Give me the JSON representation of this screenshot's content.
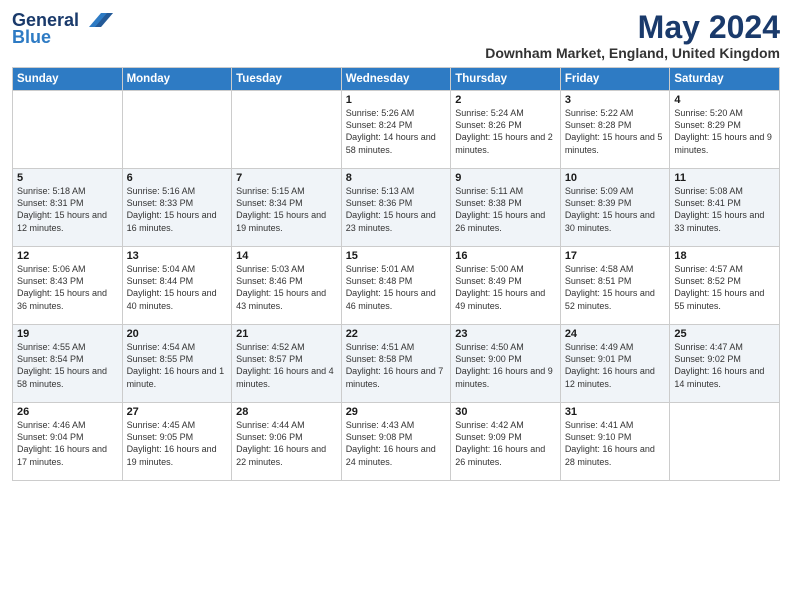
{
  "header": {
    "logo_general": "General",
    "logo_blue": "Blue",
    "month_title": "May 2024",
    "subtitle": "Downham Market, England, United Kingdom"
  },
  "days_of_week": [
    "Sunday",
    "Monday",
    "Tuesday",
    "Wednesday",
    "Thursday",
    "Friday",
    "Saturday"
  ],
  "weeks": [
    [
      {
        "day": "",
        "sunrise": "",
        "sunset": "",
        "daylight": ""
      },
      {
        "day": "",
        "sunrise": "",
        "sunset": "",
        "daylight": ""
      },
      {
        "day": "",
        "sunrise": "",
        "sunset": "",
        "daylight": ""
      },
      {
        "day": "1",
        "sunrise": "Sunrise: 5:26 AM",
        "sunset": "Sunset: 8:24 PM",
        "daylight": "Daylight: 14 hours and 58 minutes."
      },
      {
        "day": "2",
        "sunrise": "Sunrise: 5:24 AM",
        "sunset": "Sunset: 8:26 PM",
        "daylight": "Daylight: 15 hours and 2 minutes."
      },
      {
        "day": "3",
        "sunrise": "Sunrise: 5:22 AM",
        "sunset": "Sunset: 8:28 PM",
        "daylight": "Daylight: 15 hours and 5 minutes."
      },
      {
        "day": "4",
        "sunrise": "Sunrise: 5:20 AM",
        "sunset": "Sunset: 8:29 PM",
        "daylight": "Daylight: 15 hours and 9 minutes."
      }
    ],
    [
      {
        "day": "5",
        "sunrise": "Sunrise: 5:18 AM",
        "sunset": "Sunset: 8:31 PM",
        "daylight": "Daylight: 15 hours and 12 minutes."
      },
      {
        "day": "6",
        "sunrise": "Sunrise: 5:16 AM",
        "sunset": "Sunset: 8:33 PM",
        "daylight": "Daylight: 15 hours and 16 minutes."
      },
      {
        "day": "7",
        "sunrise": "Sunrise: 5:15 AM",
        "sunset": "Sunset: 8:34 PM",
        "daylight": "Daylight: 15 hours and 19 minutes."
      },
      {
        "day": "8",
        "sunrise": "Sunrise: 5:13 AM",
        "sunset": "Sunset: 8:36 PM",
        "daylight": "Daylight: 15 hours and 23 minutes."
      },
      {
        "day": "9",
        "sunrise": "Sunrise: 5:11 AM",
        "sunset": "Sunset: 8:38 PM",
        "daylight": "Daylight: 15 hours and 26 minutes."
      },
      {
        "day": "10",
        "sunrise": "Sunrise: 5:09 AM",
        "sunset": "Sunset: 8:39 PM",
        "daylight": "Daylight: 15 hours and 30 minutes."
      },
      {
        "day": "11",
        "sunrise": "Sunrise: 5:08 AM",
        "sunset": "Sunset: 8:41 PM",
        "daylight": "Daylight: 15 hours and 33 minutes."
      }
    ],
    [
      {
        "day": "12",
        "sunrise": "Sunrise: 5:06 AM",
        "sunset": "Sunset: 8:43 PM",
        "daylight": "Daylight: 15 hours and 36 minutes."
      },
      {
        "day": "13",
        "sunrise": "Sunrise: 5:04 AM",
        "sunset": "Sunset: 8:44 PM",
        "daylight": "Daylight: 15 hours and 40 minutes."
      },
      {
        "day": "14",
        "sunrise": "Sunrise: 5:03 AM",
        "sunset": "Sunset: 8:46 PM",
        "daylight": "Daylight: 15 hours and 43 minutes."
      },
      {
        "day": "15",
        "sunrise": "Sunrise: 5:01 AM",
        "sunset": "Sunset: 8:48 PM",
        "daylight": "Daylight: 15 hours and 46 minutes."
      },
      {
        "day": "16",
        "sunrise": "Sunrise: 5:00 AM",
        "sunset": "Sunset: 8:49 PM",
        "daylight": "Daylight: 15 hours and 49 minutes."
      },
      {
        "day": "17",
        "sunrise": "Sunrise: 4:58 AM",
        "sunset": "Sunset: 8:51 PM",
        "daylight": "Daylight: 15 hours and 52 minutes."
      },
      {
        "day": "18",
        "sunrise": "Sunrise: 4:57 AM",
        "sunset": "Sunset: 8:52 PM",
        "daylight": "Daylight: 15 hours and 55 minutes."
      }
    ],
    [
      {
        "day": "19",
        "sunrise": "Sunrise: 4:55 AM",
        "sunset": "Sunset: 8:54 PM",
        "daylight": "Daylight: 15 hours and 58 minutes."
      },
      {
        "day": "20",
        "sunrise": "Sunrise: 4:54 AM",
        "sunset": "Sunset: 8:55 PM",
        "daylight": "Daylight: 16 hours and 1 minute."
      },
      {
        "day": "21",
        "sunrise": "Sunrise: 4:52 AM",
        "sunset": "Sunset: 8:57 PM",
        "daylight": "Daylight: 16 hours and 4 minutes."
      },
      {
        "day": "22",
        "sunrise": "Sunrise: 4:51 AM",
        "sunset": "Sunset: 8:58 PM",
        "daylight": "Daylight: 16 hours and 7 minutes."
      },
      {
        "day": "23",
        "sunrise": "Sunrise: 4:50 AM",
        "sunset": "Sunset: 9:00 PM",
        "daylight": "Daylight: 16 hours and 9 minutes."
      },
      {
        "day": "24",
        "sunrise": "Sunrise: 4:49 AM",
        "sunset": "Sunset: 9:01 PM",
        "daylight": "Daylight: 16 hours and 12 minutes."
      },
      {
        "day": "25",
        "sunrise": "Sunrise: 4:47 AM",
        "sunset": "Sunset: 9:02 PM",
        "daylight": "Daylight: 16 hours and 14 minutes."
      }
    ],
    [
      {
        "day": "26",
        "sunrise": "Sunrise: 4:46 AM",
        "sunset": "Sunset: 9:04 PM",
        "daylight": "Daylight: 16 hours and 17 minutes."
      },
      {
        "day": "27",
        "sunrise": "Sunrise: 4:45 AM",
        "sunset": "Sunset: 9:05 PM",
        "daylight": "Daylight: 16 hours and 19 minutes."
      },
      {
        "day": "28",
        "sunrise": "Sunrise: 4:44 AM",
        "sunset": "Sunset: 9:06 PM",
        "daylight": "Daylight: 16 hours and 22 minutes."
      },
      {
        "day": "29",
        "sunrise": "Sunrise: 4:43 AM",
        "sunset": "Sunset: 9:08 PM",
        "daylight": "Daylight: 16 hours and 24 minutes."
      },
      {
        "day": "30",
        "sunrise": "Sunrise: 4:42 AM",
        "sunset": "Sunset: 9:09 PM",
        "daylight": "Daylight: 16 hours and 26 minutes."
      },
      {
        "day": "31",
        "sunrise": "Sunrise: 4:41 AM",
        "sunset": "Sunset: 9:10 PM",
        "daylight": "Daylight: 16 hours and 28 minutes."
      },
      {
        "day": "",
        "sunrise": "",
        "sunset": "",
        "daylight": ""
      }
    ]
  ]
}
